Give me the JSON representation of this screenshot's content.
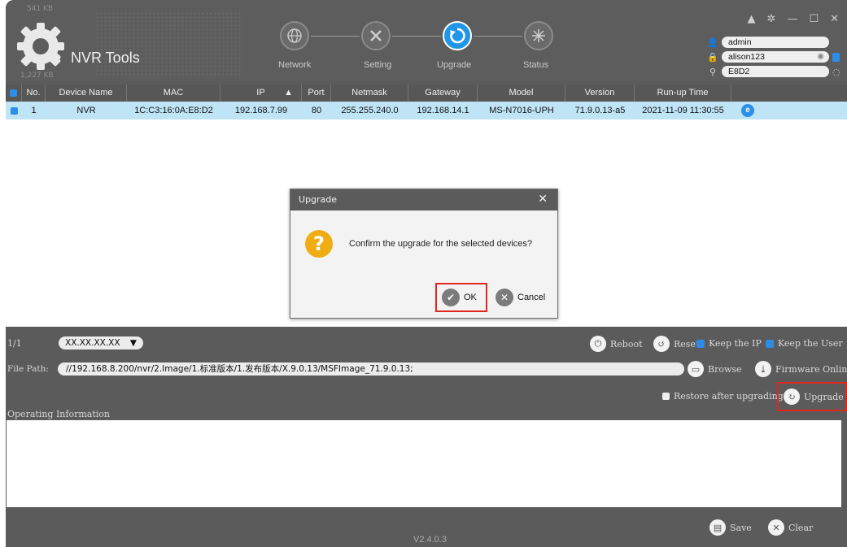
{
  "app": {
    "title": "NVR Tools",
    "version": "V2.4.0.3",
    "kb_top": "541 KB",
    "kb_side": "1,227 KB"
  },
  "steps": [
    {
      "label": "Network",
      "icon": "globe-icon",
      "active": false
    },
    {
      "label": "Setting",
      "icon": "tools-icon",
      "active": false
    },
    {
      "label": "Upgrade",
      "icon": "upgrade-icon",
      "active": true
    },
    {
      "label": "Status",
      "icon": "status-icon",
      "active": false
    }
  ],
  "window_controls": [
    "▲",
    "✲",
    "—",
    "☐",
    "✕"
  ],
  "credentials": {
    "username": "admin",
    "password": "alison123",
    "search": "E8D2"
  },
  "table": {
    "columns": [
      "No.",
      "Device Name",
      "MAC",
      "IP",
      "Port",
      "Netmask",
      "Gateway",
      "Model",
      "Version",
      "Run-up Time"
    ],
    "sort_arrow": "▲",
    "rows": [
      [
        "1",
        "NVR",
        "1C:C3:16:0A:E8:D2",
        "192.168.7.99",
        "80",
        "255.255.240.0",
        "192.168.14.1",
        "MS-N7016-UPH",
        "71.9.0.13-a5",
        "2021-11-09 11:30:55"
      ]
    ]
  },
  "dialog": {
    "title": "Upgrade",
    "close": "✕",
    "message": "Confirm the upgrade for the selected devices?",
    "ok_label": "OK",
    "cancel_label": "Cancel"
  },
  "controls": {
    "page": "1/1",
    "ip_filter": "XX.XX.XX.XX",
    "reboot_label": "Reboot",
    "reset_label": "Reset",
    "keep_ip_label": "Keep the IP",
    "keep_user_label": "Keep the User",
    "file_path_label": "File Path:",
    "file_path": "//192.168.8.200/nvr/2.Image/1.标准版本/1.发布版本/X.9.0.13/MSFImage_71.9.0.13;",
    "browse_label": "Browse",
    "firmware_online_label": "Firmware Online",
    "restore_label": "Restore after upgrading",
    "upgrade_label": "Upgrade",
    "operating_info_label": "Operating Information",
    "save_label": "Save",
    "clear_label": "Clear"
  },
  "colors": {
    "accent": "#2196e6",
    "highlight": "#e1261e",
    "selected_row": "#bfe4f6",
    "warning": "#f0ac13"
  }
}
